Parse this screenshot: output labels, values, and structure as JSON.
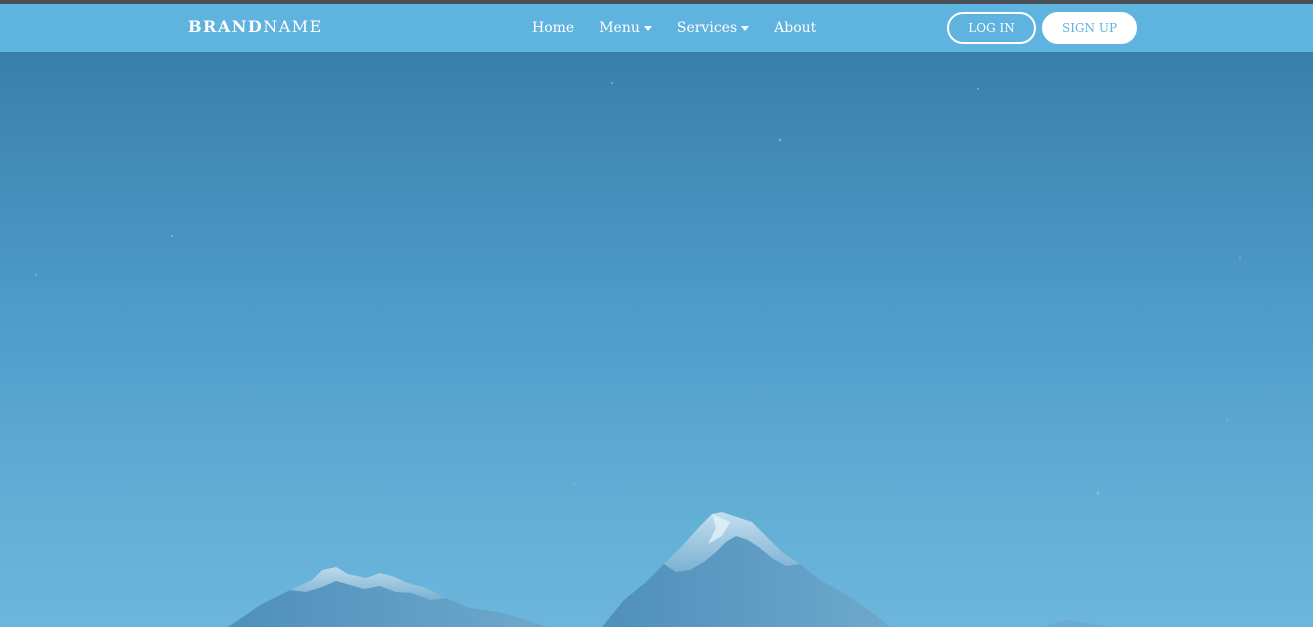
{
  "navbar": {
    "brand": {
      "bold": "BRAND",
      "regular": "NAME"
    },
    "links": [
      {
        "label": "Home",
        "has_dropdown": false
      },
      {
        "label": "Menu",
        "has_dropdown": true
      },
      {
        "label": "Services",
        "has_dropdown": true
      },
      {
        "label": "About",
        "has_dropdown": false
      }
    ],
    "login_label": "LOG IN",
    "signup_label": "SIGN UP"
  },
  "colors": {
    "navbar_background": "#5fb3df",
    "top_strip": "#4a4f55",
    "hero_top": "#3a7fab",
    "hero_bottom": "#6cb6dc",
    "button_text": "#ffffff"
  },
  "icons": {
    "dropdown": "caret-down-icon"
  },
  "hero": {
    "image_subject": "snow-capped mountain peaks under a blue sky"
  }
}
